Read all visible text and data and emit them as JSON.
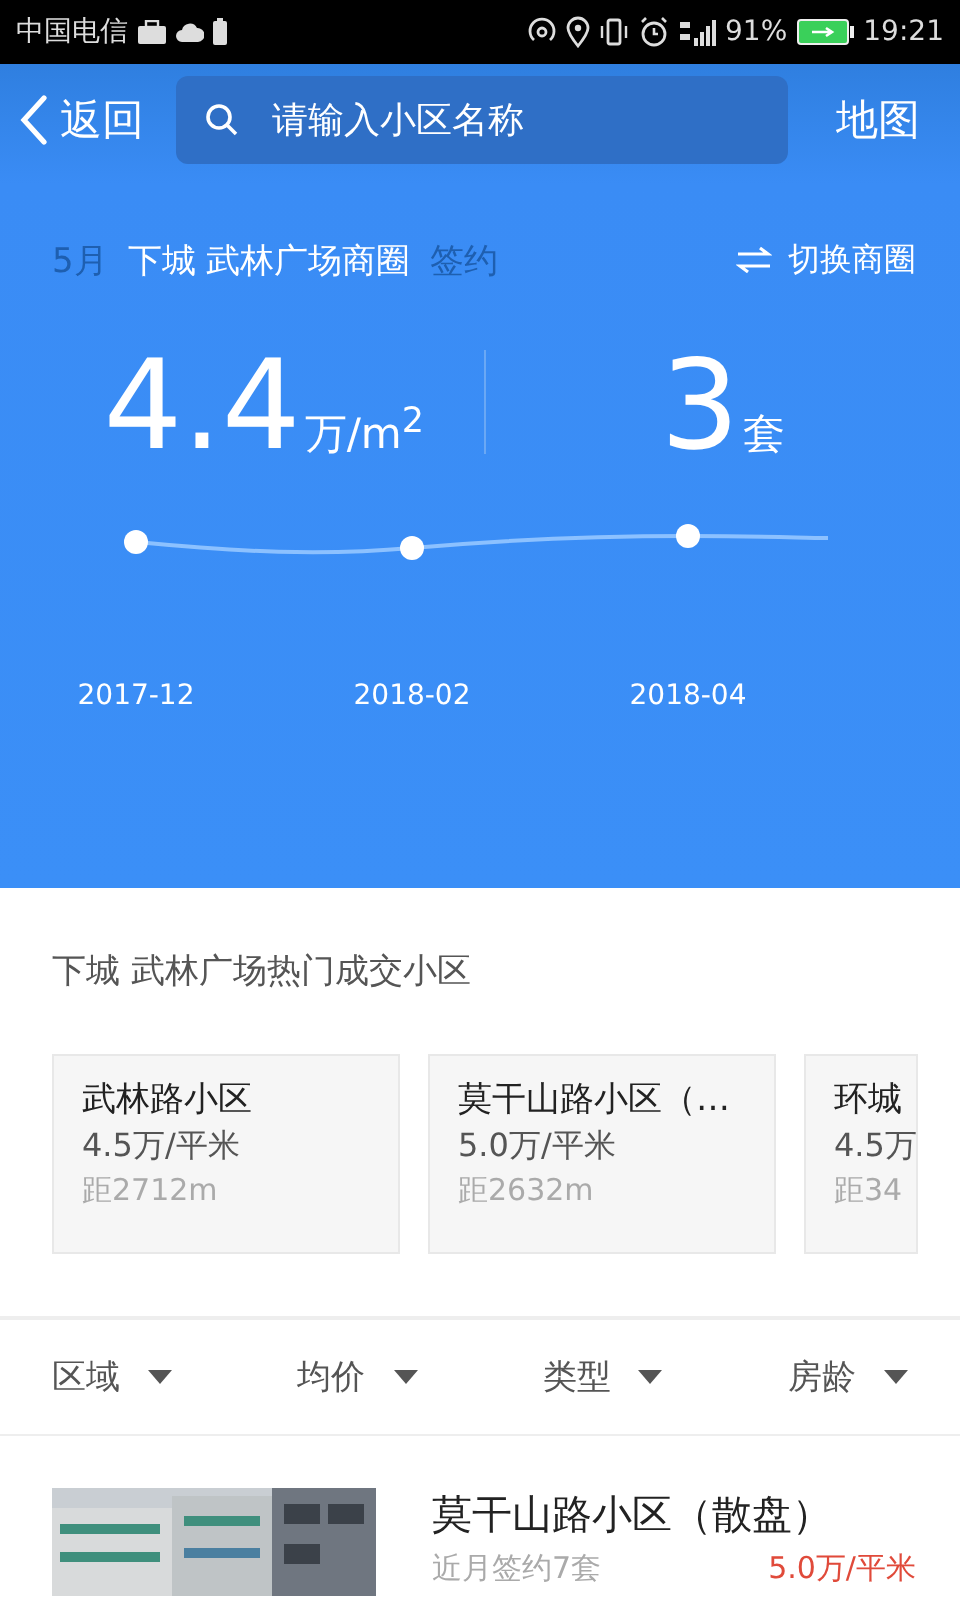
{
  "status_bar": {
    "carrier": "中国电信",
    "battery": "91%",
    "time": "19:21"
  },
  "nav": {
    "back": "返回",
    "search": {
      "placeholder": "请输入小区名称"
    },
    "map": "地图"
  },
  "summary": {
    "month": "5月",
    "area": "下城 武林广场商圈",
    "type": "签约",
    "switch": "切换商圈"
  },
  "stats": [
    {
      "value": "4.4",
      "unit": "万/m$^{2}$"
    },
    {
      "value": "3",
      "unit": "套"
    }
  ],
  "trend": {
    "dates": [
      "2017-12",
      "2018-02",
      "2018-04"
    ]
  },
  "hot": {
    "title": "下城 武林广场热门成交小区",
    "cards": [
      {
        "name": "武林路小区",
        "price": "4.5万/平米",
        "distance": "距2712m"
      },
      {
        "name": "莫干山路小区（…",
        "price": "5.0万/平米",
        "distance": "距2632m"
      },
      {
        "name": "环城",
        "price": "4.5万",
        "distance": "距34"
      }
    ]
  },
  "filters": [
    {
      "label": "区域"
    },
    {
      "label": "均价"
    },
    {
      "label": "类型"
    },
    {
      "label": "房龄"
    }
  ],
  "listings": [
    {
      "name": "莫干山路小区（散盘）",
      "deals": "近月签约7套",
      "price": "5.0万/平米"
    }
  ]
}
